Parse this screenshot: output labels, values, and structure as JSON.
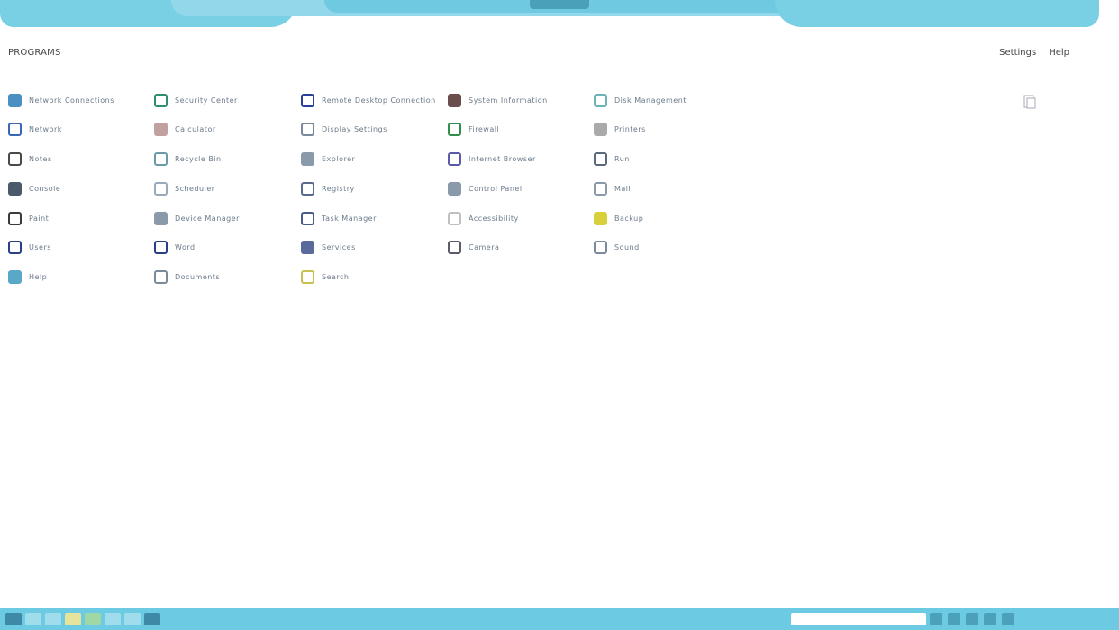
{
  "header": {
    "page_title": "PROGRAMS",
    "links": [
      "Settings",
      "Help"
    ]
  },
  "colors": {
    "accent": "#6ccbe3",
    "text": "#6a7a8a"
  },
  "programs": [
    {
      "label": "Network Connections",
      "icon": "network-icon",
      "color": "#4a90c0"
    },
    {
      "label": "Security Center",
      "icon": "shield-icon",
      "color": "#2f8f6a"
    },
    {
      "label": "Remote Desktop Connection",
      "icon": "remote-icon",
      "color": "#2a3f9a"
    },
    {
      "label": "System Information",
      "icon": "system-icon",
      "color": "#6a4d4d"
    },
    {
      "label": "Disk Management",
      "icon": "disk-icon",
      "color": "#6cb3b8"
    },
    {
      "label": "Network",
      "icon": "wifi-icon",
      "color": "#3a66b8"
    },
    {
      "label": "Calculator",
      "icon": "calculator-icon",
      "color": "#c2a0a0"
    },
    {
      "label": "Display Settings",
      "icon": "display-icon",
      "color": "#7a8a9a"
    },
    {
      "label": "Firewall",
      "icon": "firewall-icon",
      "color": "#2f8f4a"
    },
    {
      "label": "Printers",
      "icon": "printer-icon",
      "color": "#aaaaaa"
    },
    {
      "label": "Notes",
      "icon": "notes-icon",
      "color": "#4a4a4a"
    },
    {
      "label": "Recycle Bin",
      "icon": "recycle-icon",
      "color": "#6a9aa8"
    },
    {
      "label": "Explorer",
      "icon": "folder-icon",
      "color": "#8a9aaa"
    },
    {
      "label": "Internet Browser",
      "icon": "browser-icon",
      "color": "#5a5aa8"
    },
    {
      "label": "Run",
      "icon": "run-icon",
      "color": "#5a6a7a"
    },
    {
      "label": "Console",
      "icon": "console-icon",
      "color": "#4a5a6a"
    },
    {
      "label": "Scheduler",
      "icon": "scheduler-icon",
      "color": "#9aaaba"
    },
    {
      "label": "Registry",
      "icon": "registry-icon",
      "color": "#5a6a8a"
    },
    {
      "label": "Control Panel",
      "icon": "control-icon",
      "color": "#8a9aaa"
    },
    {
      "label": "Mail",
      "icon": "mail-icon",
      "color": "#8a9aaa"
    },
    {
      "label": "Paint",
      "icon": "paint-icon",
      "color": "#3a3a3a"
    },
    {
      "label": "Device Manager",
      "icon": "device-icon",
      "color": "#8a9aaa"
    },
    {
      "label": "Task Manager",
      "icon": "taskmgr-icon",
      "color": "#4a5a8a"
    },
    {
      "label": "Accessibility",
      "icon": "accessibility-icon",
      "color": "#c0c0c0"
    },
    {
      "label": "Backup",
      "icon": "backup-icon",
      "color": "#d8d03a"
    },
    {
      "label": "Users",
      "icon": "users-icon",
      "color": "#2a3f8a"
    },
    {
      "label": "Word",
      "icon": "word-icon",
      "color": "#2a3f8a"
    },
    {
      "label": "Services",
      "icon": "services-icon",
      "color": "#5a6a9a"
    },
    {
      "label": "Camera",
      "icon": "camera-icon",
      "color": "#5a5a6a"
    },
    {
      "label": "Sound",
      "icon": "sound-icon",
      "color": "#7a8a9a"
    },
    {
      "label": "Help",
      "icon": "help-icon",
      "color": "#5aa8c8"
    },
    {
      "label": "Documents",
      "icon": "documents-icon",
      "color": "#7a8a9a"
    },
    {
      "label": "Search",
      "icon": "search-icon",
      "color": "#c8c050"
    }
  ],
  "taskbar": {
    "search_placeholder": ""
  }
}
